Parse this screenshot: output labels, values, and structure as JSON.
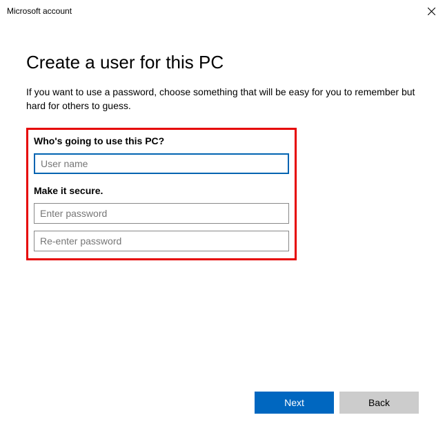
{
  "window": {
    "title": "Microsoft account"
  },
  "page": {
    "title": "Create a user for this PC",
    "description": "If you want to use a password, choose something that will be easy for you to remember but hard for others to guess."
  },
  "form": {
    "section1_label": "Who's going to use this PC?",
    "username": {
      "value": "",
      "placeholder": "User name"
    },
    "section2_label": "Make it secure.",
    "password": {
      "value": "",
      "placeholder": "Enter password"
    },
    "password_confirm": {
      "value": "",
      "placeholder": "Re-enter password"
    }
  },
  "footer": {
    "next_label": "Next",
    "back_label": "Back"
  }
}
